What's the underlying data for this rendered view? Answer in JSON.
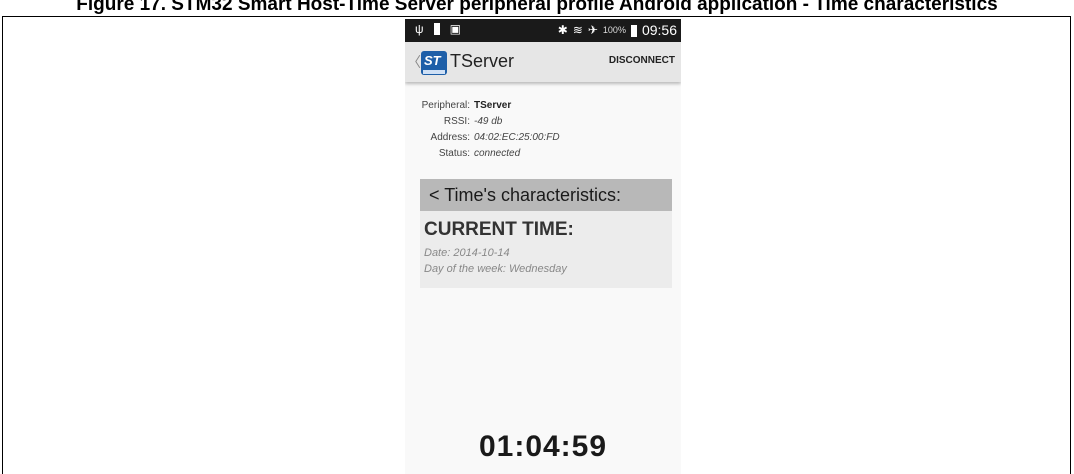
{
  "document": {
    "caption": "Figure 17. STM32 Smart Host-Time Server peripheral profile Android application - Time characteristics"
  },
  "statusbar": {
    "icons_left": [
      "usb-icon",
      "battery-icon",
      "image-icon"
    ],
    "bluetooth_glyph": "✱",
    "signal_glyph": "≋",
    "airplane_glyph": "✈",
    "usb_glyph": "ψ",
    "image_glyph": "▣",
    "battery_percent": "100%",
    "time": "09:56"
  },
  "actionbar": {
    "up_glyph": "〈",
    "logo_text": "ST",
    "title": "TServer",
    "disconnect_label": "DISCONNECT"
  },
  "peripheral": {
    "peripheral_label": "Peripheral:",
    "peripheral_value": "TServer",
    "rssi_label": "RSSI:",
    "rssi_value": "-49 db",
    "address_label": "Address:",
    "address_value": "04:02:EC:25:00:FD",
    "status_label": "Status:",
    "status_value": "connected"
  },
  "characteristics": {
    "header": "<  Time's characteristics:",
    "card_title": "CURRENT TIME:",
    "date_line": "Date: 2014-10-14",
    "day_line": "Day of the week: Wednesday"
  },
  "clock": {
    "value": "01:04:59"
  },
  "colors": {
    "statusbar_bg": "#1a1a1a",
    "actionbar_bg": "#e6e6e6",
    "header_bg": "#b8b8b8",
    "card_bg": "#ececec",
    "logo_blue": "#1e5fa8"
  }
}
